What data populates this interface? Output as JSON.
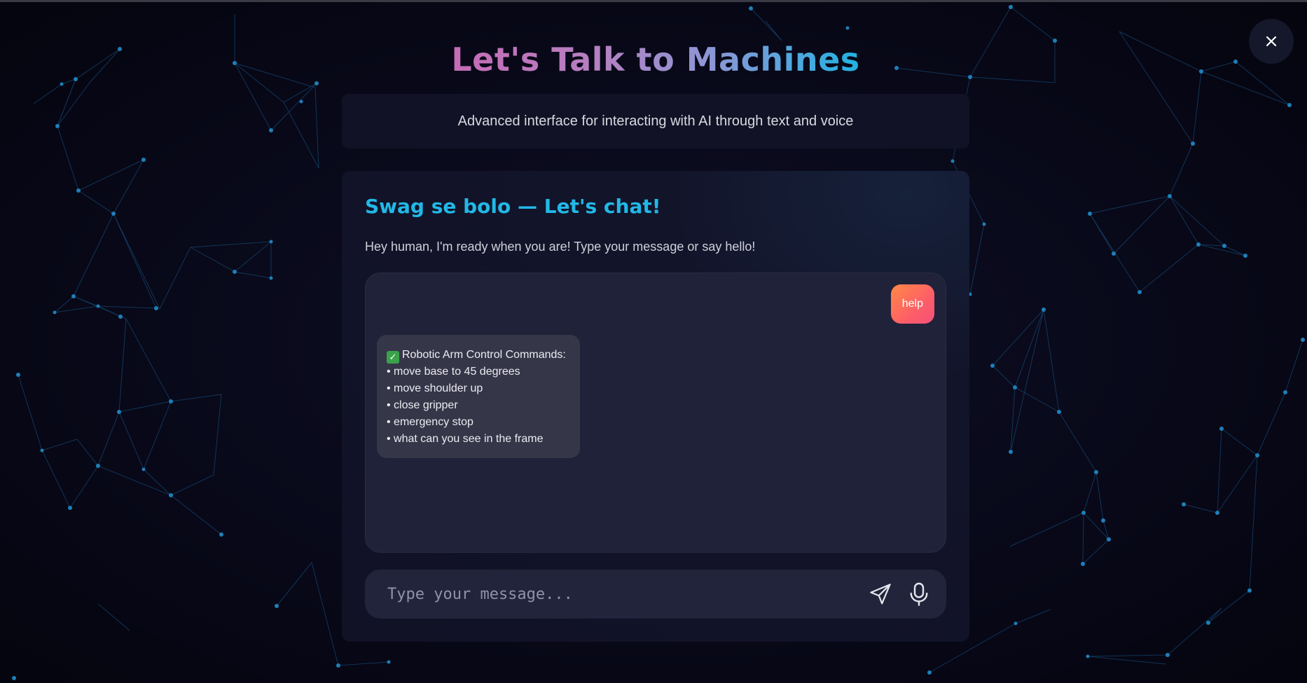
{
  "app": {
    "title": "Let's Talk to Machines",
    "subtitle": "Advanced interface for interacting with AI through text and voice",
    "close_label": "×"
  },
  "chat_card": {
    "heading": "Swag se bolo — Let's chat!",
    "intro": "Hey human, I'm ready when you are! Type your message or say hello!"
  },
  "messages": {
    "user": "help",
    "bot_title": "Robotic Arm Control Commands:",
    "bot_lines": [
      "• move base to 45 degrees",
      "• move shoulder up",
      "• close gripper",
      "• emergency stop",
      "• what can you see in the frame"
    ]
  },
  "composer": {
    "placeholder": "Type your message...",
    "value": ""
  },
  "icons": {
    "send": "send-icon",
    "mic": "microphone-icon",
    "close": "close-icon",
    "check": "check-mark-icon"
  },
  "colors": {
    "accent": "#22b8e6",
    "user_bubble_start": "#ff8a45",
    "user_bubble_end": "#f44f7a",
    "network_line": "#1a5a8c",
    "network_node": "#1e7fb8"
  }
}
